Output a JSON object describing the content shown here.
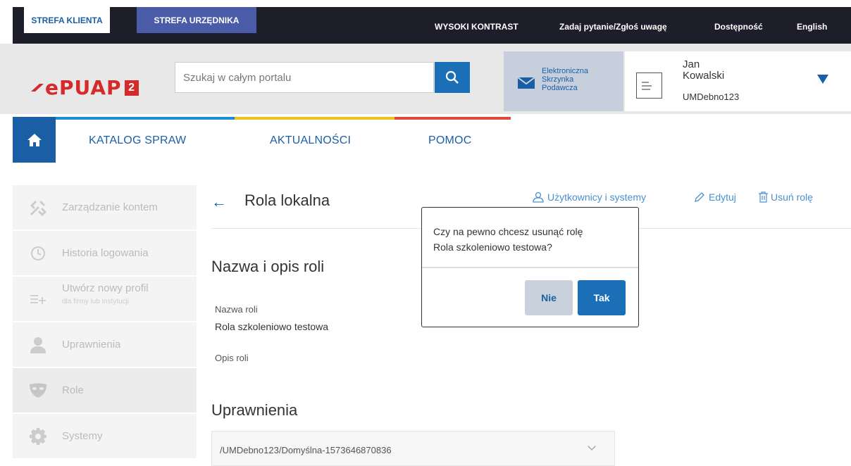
{
  "topbar": {
    "tab_klient": "STREFA KLIENTA",
    "tab_urzednik": "STREFA URZĘDNIKA",
    "contrast": "WYSOKI KONTRAST",
    "feedback": "Zadaj pytanie/Zgłoś uwagę",
    "accessibility": "Dostępność",
    "language": "English"
  },
  "header": {
    "logo_text": "ePUAP",
    "logo_badge": "2",
    "search_placeholder": "Szukaj w całym portalu",
    "esp_line1": "Elektroniczna",
    "esp_line2": "Skrzynka",
    "esp_line3": "Podawcza",
    "user_first": "Jan",
    "user_last": "Kowalski",
    "user_login": "UMDebno123"
  },
  "nav": {
    "items": [
      "KATALOG SPRAW",
      "AKTUALNOŚCI",
      "POMOC"
    ]
  },
  "sidebar": {
    "items": [
      {
        "label": "Zarządzanie kontem"
      },
      {
        "label": "Historia logowania"
      },
      {
        "label": "Utwórz nowy profil",
        "sub": "dla firmy lub instytucji"
      },
      {
        "label": "Uprawnienia"
      },
      {
        "label": "Role"
      },
      {
        "label": "Systemy"
      }
    ]
  },
  "main": {
    "title": "Rola lokalna",
    "action_users": "Użytkownicy i systemy",
    "action_edit": "Edytuj",
    "action_delete": "Usuń rolę",
    "section_name": "Nazwa i opis roli",
    "label_name": "Nazwa roli",
    "value_name": "Rola szkoleniowo testowa",
    "label_desc": "Opis roli",
    "section_perms": "Uprawnienia",
    "perm_item": "/UMDebno123/Domyślna-1573646870836"
  },
  "dialog": {
    "line1": "Czy na pewno chcesz usunąć rolę",
    "line2": "Rola szkoleniowo testowa?",
    "btn_no": "Nie",
    "btn_yes": "Tak"
  },
  "colors": {
    "accent": "#1a5fa6",
    "brand_red": "#d6292a",
    "stripe_blue": "#1a8fd8",
    "stripe_yellow": "#f2c01e",
    "stripe_red": "#e04a3a"
  }
}
